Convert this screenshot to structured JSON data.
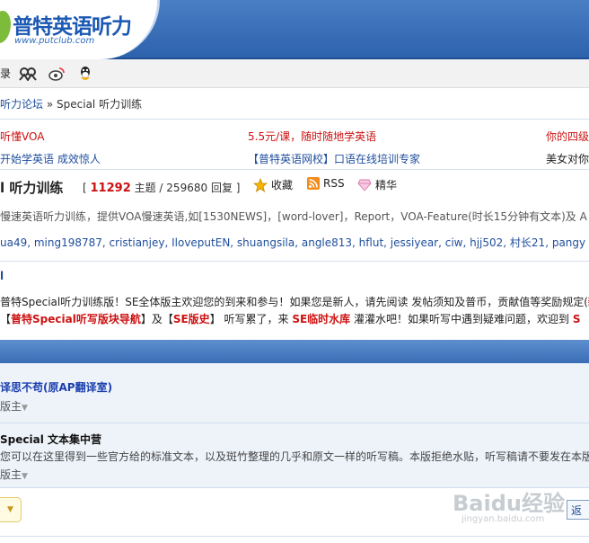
{
  "header": {
    "logo_text": "普特英语听力",
    "logo_url": "www.putclub.com"
  },
  "toolbar": {
    "login_label": "录"
  },
  "breadcrumb": {
    "forum_link": "听力论坛",
    "separator": "»",
    "current": "Special 听力训练"
  },
  "ads": {
    "row1": [
      "听懂VOA",
      "5.5元/课，随时随地学英语",
      "你的四级"
    ],
    "row2": [
      "开始学英语 成效惊人",
      "【普特英语网校】口语在线培训专家",
      "美女对你"
    ]
  },
  "forum": {
    "title": "l 听力训练",
    "topics": "11292",
    "topics_label": "主题",
    "replies": "259680",
    "replies_label": "回复",
    "open_bracket": "[",
    "slash": "/",
    "close_bracket": "]",
    "favorite_label": "收藏",
    "rss_label": "RSS",
    "digest_label": "精华",
    "description": "慢速英语听力训练，提供VOA慢速英语,如[1530NEWS]，[word-lover]，Report，VOA-Feature(时长15分钟有文本)及 A",
    "moderators": "ua49, ming198787, cristianjey, IloveputEN, shuangsila, angle813, hflut, jessiyear, ciw, hjj502, 村长21, pangy"
  },
  "rules": {
    "marker": "l",
    "line1_text": "普特Special听力训练版！SE全体版主欢迎您的到来和参与！如果您是新人，请先阅读 发帖须知及普币，贡献值等奖励规定(",
    "line1_hl": "新",
    "line2_pre1": "【",
    "line2_hl1": "普特Special听写版块导航",
    "line2_mid1": "】及【",
    "line2_hl2": "SE版史",
    "line2_mid2": "】 听写累了，来 ",
    "line2_hl3": "SE临时水库",
    "line2_post": " 灌灌水吧！如果听写中遇到疑难问题，欢迎到 ",
    "line2_hl4": "S"
  },
  "subforums": [
    {
      "name": "译思不苟(原AP翻译室)",
      "mod_label": "版主"
    },
    {
      "name": "Special 文本集中营",
      "description": "您可以在这里得到一些官方给的标准文本，以及斑竹整理的几乎和原文一样的听写稿。本版拒绝水贴，听写稿请不要发在本版",
      "mod_label": "版主"
    }
  ],
  "bottom": {
    "return_label": "返"
  },
  "watermark": {
    "brand": "Baidu经验",
    "url": "jingyan.baidu.com"
  },
  "colors": {
    "header_blue": "#2d62ad",
    "link_blue": "#1f4e9c",
    "accent_red": "#cc1111"
  }
}
